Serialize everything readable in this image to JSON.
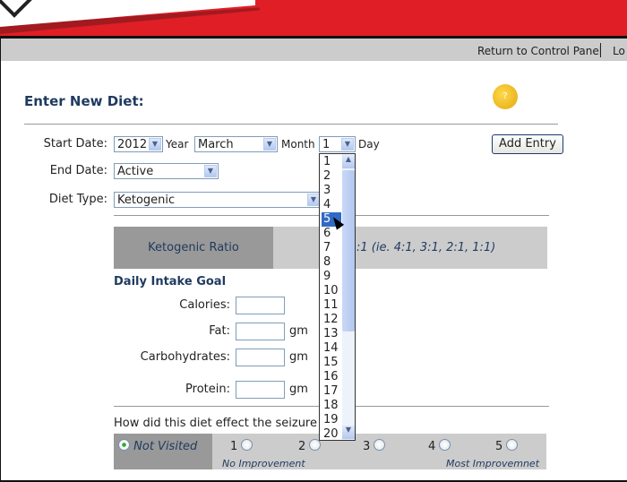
{
  "nav": {
    "return": "Return to Control Panel",
    "logout": "Lo"
  },
  "page": {
    "title": "Enter New Diet:",
    "help_icon": "help-sticker-icon"
  },
  "form": {
    "start_label": "Start Date:",
    "year": "2012",
    "year_label": "Year",
    "month": "March",
    "month_label": "Month",
    "day": "1",
    "day_label": "Day",
    "add_entry": "Add Entry",
    "end_label": "End Date:",
    "end": "Active",
    "diet_label": "Diet Type:",
    "diet": "Ketogenic",
    "ratio_label": "Ketogenic Ratio",
    "ratio_hint": ":1  (ie. 4:1, 3:1, 2:1, 1:1)",
    "intake_title": "Daily Intake Goal",
    "calories": "Calories:",
    "fat": "Fat:",
    "carbs": "Carbohydrates:",
    "protein": "Protein:",
    "unit": "gm",
    "question": "How did this diet effect the seizure ac",
    "not_visited": "Not Visited",
    "r1": "1",
    "r2": "2",
    "r3": "3",
    "r4": "4",
    "r5": "5",
    "low": "No Improvement",
    "high": "Most Improvemnet"
  },
  "day_options": [
    "1",
    "2",
    "3",
    "4",
    "5",
    "6",
    "7",
    "8",
    "9",
    "10",
    "11",
    "12",
    "13",
    "14",
    "15",
    "16",
    "17",
    "18",
    "19",
    "20"
  ],
  "day_highlighted": "5"
}
